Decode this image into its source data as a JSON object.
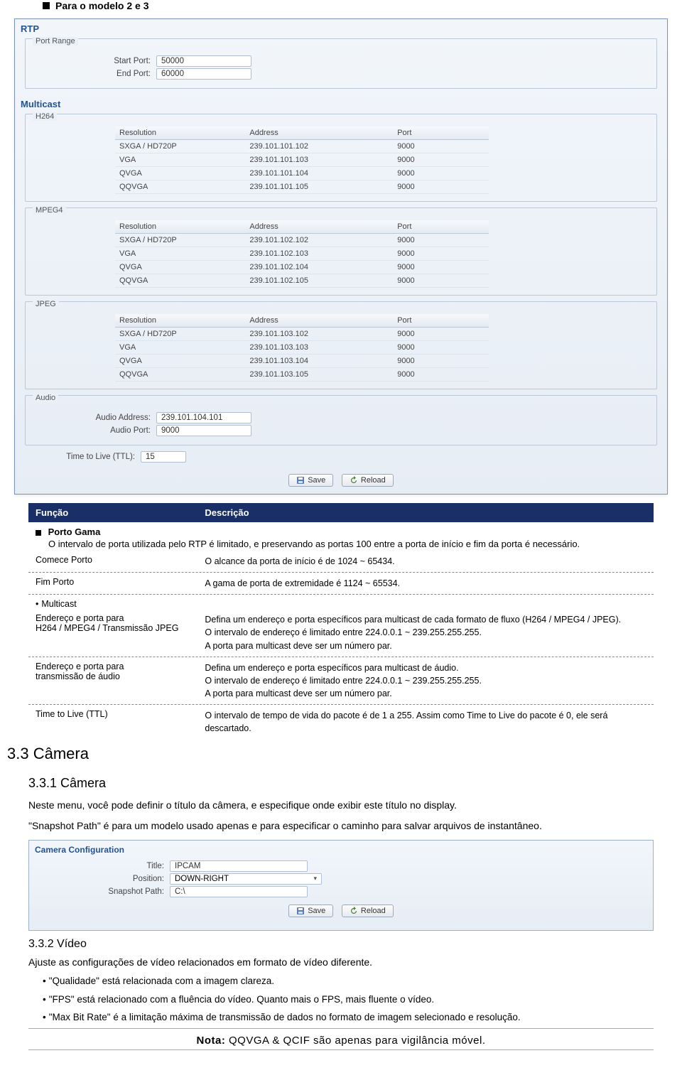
{
  "heading1": "Para o modelo 2 e 3",
  "rtp": {
    "title": "RTP",
    "portRange": {
      "legend": "Port Range",
      "startLabel": "Start Port:",
      "startValue": "50000",
      "endLabel": "End Port:",
      "endValue": "60000"
    }
  },
  "multicast": {
    "title": "Multicast",
    "cols": {
      "res": "Resolution",
      "addr": "Address",
      "port": "Port"
    },
    "h264": {
      "legend": "H264",
      "rows": [
        {
          "res": "SXGA / HD720P",
          "addr": "239.101.101.102",
          "port": "9000"
        },
        {
          "res": "VGA",
          "addr": "239.101.101.103",
          "port": "9000"
        },
        {
          "res": "QVGA",
          "addr": "239.101.101.104",
          "port": "9000"
        },
        {
          "res": "QQVGA",
          "addr": "239.101.101.105",
          "port": "9000"
        }
      ]
    },
    "mpeg4": {
      "legend": "MPEG4",
      "rows": [
        {
          "res": "SXGA / HD720P",
          "addr": "239.101.102.102",
          "port": "9000"
        },
        {
          "res": "VGA",
          "addr": "239.101.102.103",
          "port": "9000"
        },
        {
          "res": "QVGA",
          "addr": "239.101.102.104",
          "port": "9000"
        },
        {
          "res": "QQVGA",
          "addr": "239.101.102.105",
          "port": "9000"
        }
      ]
    },
    "jpeg": {
      "legend": "JPEG",
      "rows": [
        {
          "res": "SXGA / HD720P",
          "addr": "239.101.103.102",
          "port": "9000"
        },
        {
          "res": "VGA",
          "addr": "239.101.103.103",
          "port": "9000"
        },
        {
          "res": "QVGA",
          "addr": "239.101.103.104",
          "port": "9000"
        },
        {
          "res": "QQVGA",
          "addr": "239.101.103.105",
          "port": "9000"
        }
      ]
    },
    "audio": {
      "legend": "Audio",
      "addrLabel": "Audio Address:",
      "addrValue": "239.101.104.101",
      "portLabel": "Audio Port:",
      "portValue": "9000"
    },
    "ttl": {
      "label": "Time to Live (TTL):",
      "value": "15"
    }
  },
  "buttons": {
    "save": "Save",
    "reload": "Reload"
  },
  "desc": {
    "h1": "Função",
    "h2": "Descrição",
    "portoGama": "Porto Gama",
    "portoGamaDesc": "O intervalo de porta utilizada pelo RTP é limitado, e preservando as portas 100 entre a porta de início e fim da porta é necessário.",
    "row1k": "Comece Porto",
    "row1v": "O alcance da porta de início é de 1024 ~ 65434.",
    "row2k": "Fim Porto",
    "row2v": "A gama de porta de extremidade é 1124 ~ 65534.",
    "multicast": "Multicast",
    "row3k": "Endereço e porta para\nH264 / MPEG4 / Transmissão JPEG",
    "row3v1": "Defina um endereço e porta específicos para multicast de cada formato de fluxo (H264 / MPEG4 / JPEG).",
    "row3v2": "O intervalo de endereço é limitado entre 224.0.0.1 ~ 239.255.255.255.",
    "row3v3": "A porta para multicast deve ser um número par.",
    "row4k": "Endereço e porta para\ntransmissão de áudio",
    "row4v1": "Defina um endereço e porta específicos para multicast de áudio.",
    "row4v2": "O intervalo de endereço é limitado entre 224.0.0.1 ~ 239.255.255.255.",
    "row4v3": "A porta para multicast deve ser um número par.",
    "row5k": "Time to Live (TTL)",
    "row5v": "O intervalo de tempo de vida do pacote é de 1 a 255. Assim como Time to Live do pacote é 0, ele será descartado."
  },
  "sec33": "3.3 Câmera",
  "sec331": "3.3.1 Câmera",
  "p1": "Neste menu, você pode definir o título da câmera, e especifique onde exibir este título no display.",
  "p2": "\"Snapshot Path\" é para um modelo usado apenas e para especificar o caminho para salvar arquivos de instantâneo.",
  "cc": {
    "title": "Camera Configuration",
    "titleLabel": "Title:",
    "titleValue": "IPCAM",
    "posLabel": "Position:",
    "posValue": "DOWN-RIGHT",
    "snapLabel": "Snapshot Path:",
    "snapValue": "C:\\"
  },
  "sec332": "3.3.2 Vídeo",
  "p3": "Ajuste as configurações de vídeo relacionados em formato de vídeo diferente.",
  "b1": "\"Qualidade\" está relacionada com a imagem clareza.",
  "b2": "\"FPS\" está relacionado com a fluência do vídeo. Quanto mais o FPS, mais fluente o vídeo.",
  "b3": "\"Max Bit Rate\" é a limitação máxima de transmissão de dados no formato de imagem selecionado e resolução.",
  "notaLabel": "Nota:",
  "notaText": " QQVGA & QCIF são apenas para vigilância móvel."
}
